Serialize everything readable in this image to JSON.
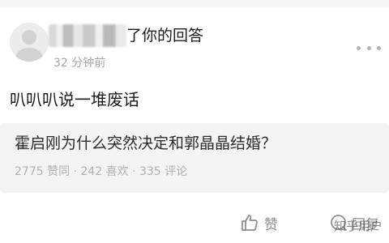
{
  "notification": {
    "action_text": "了你的回答",
    "time_ago": "32 分钟前"
  },
  "comment": {
    "text": "叭叭叭说一堆废话"
  },
  "question": {
    "title": "霍启刚为什么突然决定和郭晶晶结婚？",
    "stats": "2775 赞同 · 242 喜欢 · 335 评论"
  },
  "actions": {
    "like_label": "赞",
    "reply_label": "回复"
  },
  "watermark": {
    "text": "知乎用户"
  },
  "icons": {
    "more": "more-dots-icon",
    "like": "thumbs-up-icon",
    "reply": "comment-bubble-icon"
  },
  "colors": {
    "background": "#ffffff",
    "card_background": "#f4f4f4",
    "secondary_text": "#a7a7a7",
    "primary_text": "#1a1a1a"
  }
}
